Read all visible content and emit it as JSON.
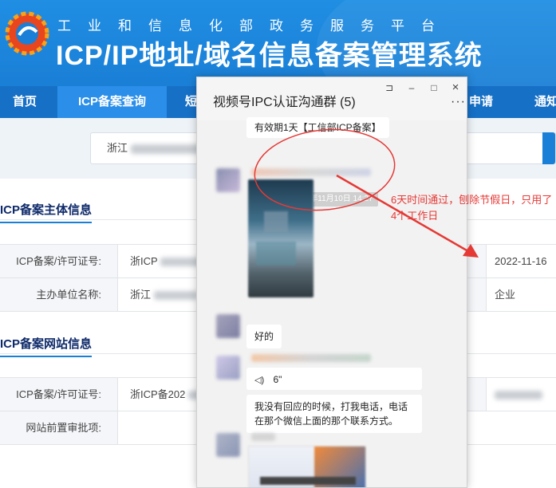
{
  "header": {
    "subtitle": "工业和信息化部政务服务平台",
    "title": "ICP/IP地址/域名信息备案管理系统"
  },
  "nav": {
    "items": [
      {
        "label": "首页"
      },
      {
        "label": "ICP备案查询"
      },
      {
        "label": "短"
      },
      {
        "label": "申请"
      },
      {
        "label": "通知"
      }
    ]
  },
  "search": {
    "value_visible_prefix": "浙江"
  },
  "sections": {
    "subject_info": "ICP备案主体信息",
    "website_info": "ICP备案网站信息"
  },
  "subject_table": [
    {
      "label": "ICP备案/许可证号:",
      "value": "浙ICP",
      "right_value": "2022-11-16"
    },
    {
      "label": "主办单位名称:",
      "value": "浙江",
      "right_value": "企业"
    }
  ],
  "website_table": [
    {
      "label": "ICP备案/许可证号:",
      "value": "浙ICP备202",
      "right_value": ""
    },
    {
      "label": "网站前置审批项:",
      "value": "",
      "right_value": ""
    }
  ],
  "chat": {
    "title": "视频号IPC认证沟通群 (5)",
    "controls": {
      "pin": "⊐",
      "minimize": "–",
      "maximize": "□",
      "close": "×",
      "more": "···"
    },
    "messages": {
      "top_fragment": "有效期1天【工信部ICP备案】",
      "timestamp": "2022年11月10日 14:27",
      "reply_ok": "好的",
      "voice_duration": "6\"",
      "long_text": "我没有回应的时候，打我电话，电话在那个微信上面的那个联系方式。"
    }
  },
  "annotation": {
    "text": "6天时间通过，刨除节假日，只用了4个工作日",
    "color": "#e53935"
  }
}
